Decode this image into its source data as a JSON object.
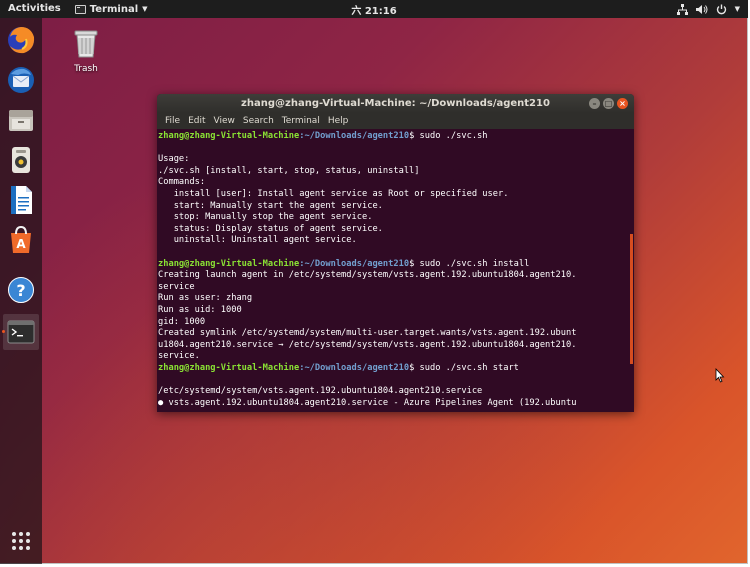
{
  "topbar": {
    "activities": "Activities",
    "app_name": "Terminal",
    "clock": "六 21:16"
  },
  "desktop": {
    "trash_label": "Trash"
  },
  "dock": {
    "items": [
      "firefox-icon",
      "thunderbird-icon",
      "files-icon",
      "rhythmbox-icon",
      "writer-icon",
      "software-icon",
      "help-icon",
      "terminal-icon"
    ]
  },
  "terminal": {
    "title": "zhang@zhang-Virtual-Machine: ~/Downloads/agent210",
    "menu": [
      "File",
      "Edit",
      "View",
      "Search",
      "Terminal",
      "Help"
    ],
    "prompt_user": "zhang@zhang-Virtual-Machine",
    "prompt_path": ":~/Downloads/agent210",
    "lines": [
      {
        "type": "prompt",
        "cmd": "$ sudo ./svc.sh"
      },
      {
        "type": "text",
        "text": ""
      },
      {
        "type": "text",
        "text": "Usage:"
      },
      {
        "type": "text",
        "text": "./svc.sh [install, start, stop, status, uninstall]"
      },
      {
        "type": "text",
        "text": "Commands:"
      },
      {
        "type": "text",
        "text": "   install [user]: Install agent service as Root or specified user."
      },
      {
        "type": "text",
        "text": "   start: Manually start the agent service."
      },
      {
        "type": "text",
        "text": "   stop: Manually stop the agent service."
      },
      {
        "type": "text",
        "text": "   status: Display status of agent service."
      },
      {
        "type": "text",
        "text": "   uninstall: Uninstall agent service."
      },
      {
        "type": "text",
        "text": ""
      },
      {
        "type": "prompt",
        "cmd": "$ sudo ./svc.sh install"
      },
      {
        "type": "text",
        "text": "Creating launch agent in /etc/systemd/system/vsts.agent.192.ubuntu1804.agent210."
      },
      {
        "type": "text",
        "text": "service"
      },
      {
        "type": "text",
        "text": "Run as user: zhang"
      },
      {
        "type": "text",
        "text": "Run as uid: 1000"
      },
      {
        "type": "text",
        "text": "gid: 1000"
      },
      {
        "type": "text",
        "text": "Created symlink /etc/systemd/system/multi-user.target.wants/vsts.agent.192.ubunt"
      },
      {
        "type": "text",
        "text": "u1804.agent210.service → /etc/systemd/system/vsts.agent.192.ubuntu1804.agent210."
      },
      {
        "type": "text",
        "text": "service."
      },
      {
        "type": "prompt",
        "cmd": "$ sudo ./svc.sh start"
      },
      {
        "type": "text",
        "text": ""
      },
      {
        "type": "text",
        "text": "/etc/systemd/system/vsts.agent.192.ubuntu1804.agent210.service"
      },
      {
        "type": "text",
        "text": "● vsts.agent.192.ubuntu1804.agent210.service - Azure Pipelines Agent (192.ubuntu"
      }
    ]
  }
}
